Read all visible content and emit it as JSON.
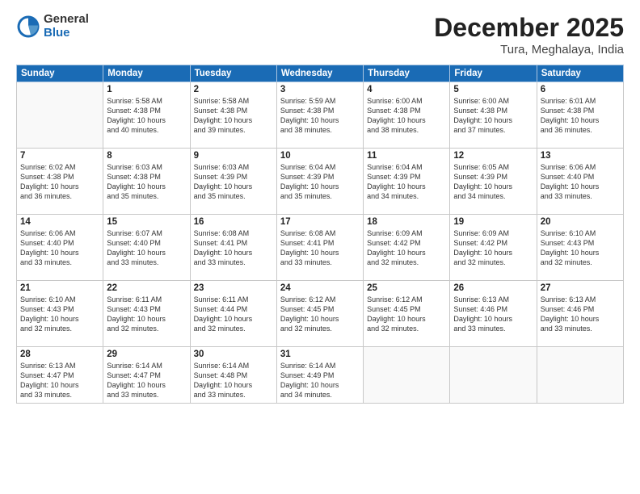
{
  "logo": {
    "general": "General",
    "blue": "Blue"
  },
  "header": {
    "month": "December 2025",
    "location": "Tura, Meghalaya, India"
  },
  "days": [
    "Sunday",
    "Monday",
    "Tuesday",
    "Wednesday",
    "Thursday",
    "Friday",
    "Saturday"
  ],
  "weeks": [
    [
      {
        "date": "",
        "info": ""
      },
      {
        "date": "1",
        "info": "Sunrise: 5:58 AM\nSunset: 4:38 PM\nDaylight: 10 hours\nand 40 minutes."
      },
      {
        "date": "2",
        "info": "Sunrise: 5:58 AM\nSunset: 4:38 PM\nDaylight: 10 hours\nand 39 minutes."
      },
      {
        "date": "3",
        "info": "Sunrise: 5:59 AM\nSunset: 4:38 PM\nDaylight: 10 hours\nand 38 minutes."
      },
      {
        "date": "4",
        "info": "Sunrise: 6:00 AM\nSunset: 4:38 PM\nDaylight: 10 hours\nand 38 minutes."
      },
      {
        "date": "5",
        "info": "Sunrise: 6:00 AM\nSunset: 4:38 PM\nDaylight: 10 hours\nand 37 minutes."
      },
      {
        "date": "6",
        "info": "Sunrise: 6:01 AM\nSunset: 4:38 PM\nDaylight: 10 hours\nand 36 minutes."
      }
    ],
    [
      {
        "date": "7",
        "info": "Sunrise: 6:02 AM\nSunset: 4:38 PM\nDaylight: 10 hours\nand 36 minutes."
      },
      {
        "date": "8",
        "info": "Sunrise: 6:03 AM\nSunset: 4:38 PM\nDaylight: 10 hours\nand 35 minutes."
      },
      {
        "date": "9",
        "info": "Sunrise: 6:03 AM\nSunset: 4:39 PM\nDaylight: 10 hours\nand 35 minutes."
      },
      {
        "date": "10",
        "info": "Sunrise: 6:04 AM\nSunset: 4:39 PM\nDaylight: 10 hours\nand 35 minutes."
      },
      {
        "date": "11",
        "info": "Sunrise: 6:04 AM\nSunset: 4:39 PM\nDaylight: 10 hours\nand 34 minutes."
      },
      {
        "date": "12",
        "info": "Sunrise: 6:05 AM\nSunset: 4:39 PM\nDaylight: 10 hours\nand 34 minutes."
      },
      {
        "date": "13",
        "info": "Sunrise: 6:06 AM\nSunset: 4:40 PM\nDaylight: 10 hours\nand 33 minutes."
      }
    ],
    [
      {
        "date": "14",
        "info": "Sunrise: 6:06 AM\nSunset: 4:40 PM\nDaylight: 10 hours\nand 33 minutes."
      },
      {
        "date": "15",
        "info": "Sunrise: 6:07 AM\nSunset: 4:40 PM\nDaylight: 10 hours\nand 33 minutes."
      },
      {
        "date": "16",
        "info": "Sunrise: 6:08 AM\nSunset: 4:41 PM\nDaylight: 10 hours\nand 33 minutes."
      },
      {
        "date": "17",
        "info": "Sunrise: 6:08 AM\nSunset: 4:41 PM\nDaylight: 10 hours\nand 33 minutes."
      },
      {
        "date": "18",
        "info": "Sunrise: 6:09 AM\nSunset: 4:42 PM\nDaylight: 10 hours\nand 32 minutes."
      },
      {
        "date": "19",
        "info": "Sunrise: 6:09 AM\nSunset: 4:42 PM\nDaylight: 10 hours\nand 32 minutes."
      },
      {
        "date": "20",
        "info": "Sunrise: 6:10 AM\nSunset: 4:43 PM\nDaylight: 10 hours\nand 32 minutes."
      }
    ],
    [
      {
        "date": "21",
        "info": "Sunrise: 6:10 AM\nSunset: 4:43 PM\nDaylight: 10 hours\nand 32 minutes."
      },
      {
        "date": "22",
        "info": "Sunrise: 6:11 AM\nSunset: 4:43 PM\nDaylight: 10 hours\nand 32 minutes."
      },
      {
        "date": "23",
        "info": "Sunrise: 6:11 AM\nSunset: 4:44 PM\nDaylight: 10 hours\nand 32 minutes."
      },
      {
        "date": "24",
        "info": "Sunrise: 6:12 AM\nSunset: 4:45 PM\nDaylight: 10 hours\nand 32 minutes."
      },
      {
        "date": "25",
        "info": "Sunrise: 6:12 AM\nSunset: 4:45 PM\nDaylight: 10 hours\nand 32 minutes."
      },
      {
        "date": "26",
        "info": "Sunrise: 6:13 AM\nSunset: 4:46 PM\nDaylight: 10 hours\nand 33 minutes."
      },
      {
        "date": "27",
        "info": "Sunrise: 6:13 AM\nSunset: 4:46 PM\nDaylight: 10 hours\nand 33 minutes."
      }
    ],
    [
      {
        "date": "28",
        "info": "Sunrise: 6:13 AM\nSunset: 4:47 PM\nDaylight: 10 hours\nand 33 minutes."
      },
      {
        "date": "29",
        "info": "Sunrise: 6:14 AM\nSunset: 4:47 PM\nDaylight: 10 hours\nand 33 minutes."
      },
      {
        "date": "30",
        "info": "Sunrise: 6:14 AM\nSunset: 4:48 PM\nDaylight: 10 hours\nand 33 minutes."
      },
      {
        "date": "31",
        "info": "Sunrise: 6:14 AM\nSunset: 4:49 PM\nDaylight: 10 hours\nand 34 minutes."
      },
      {
        "date": "",
        "info": ""
      },
      {
        "date": "",
        "info": ""
      },
      {
        "date": "",
        "info": ""
      }
    ]
  ]
}
